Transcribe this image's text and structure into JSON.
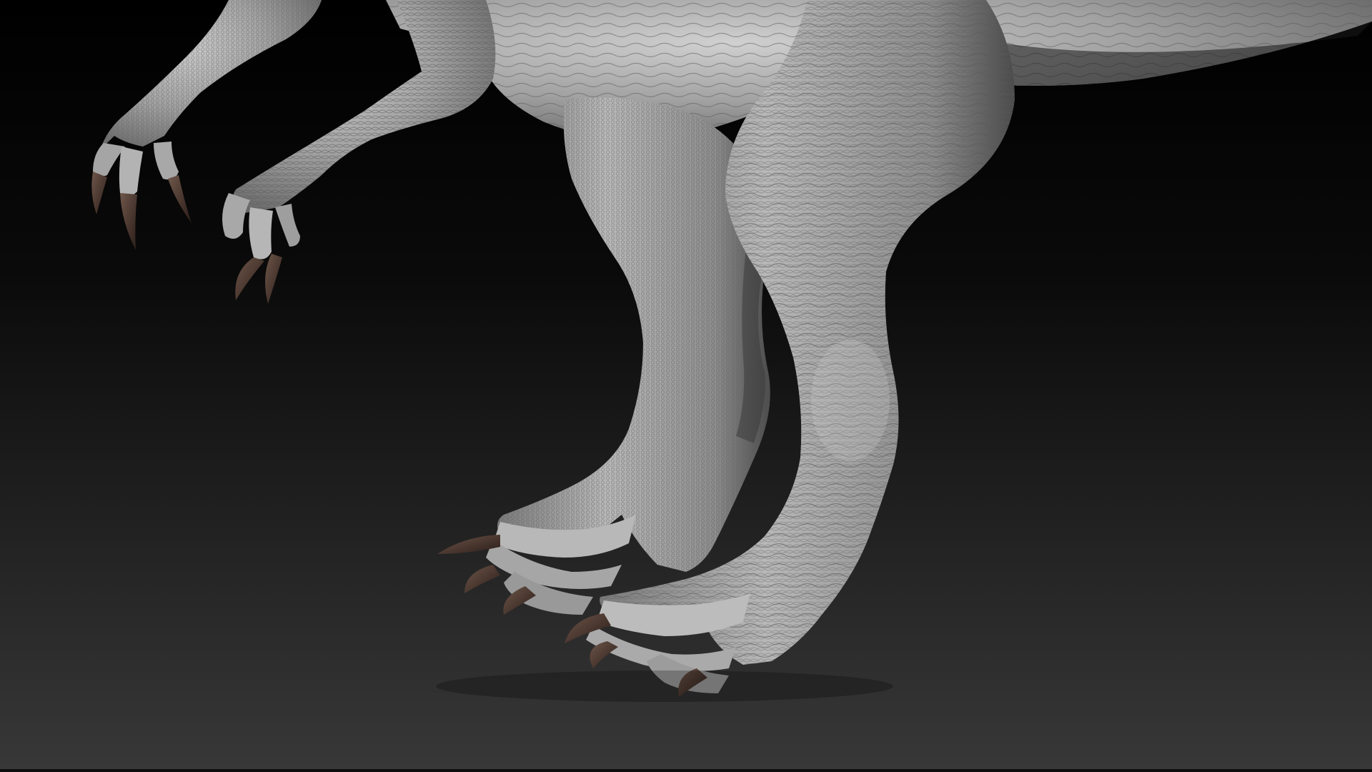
{
  "scene": {
    "subject": "sculpted-dinosaur-legs-and-arms",
    "background_gradient": [
      "#000000",
      "#0b0b0b",
      "#2e2e2e",
      "#3a3a3a"
    ],
    "skin_color": "#9c9c9c",
    "skin_shadow_color": "#4a4a4a",
    "skin_highlight_color": "#d6d6d6",
    "claw_color": "#3a2a24",
    "claw_highlight_color": "#7a5f52"
  }
}
